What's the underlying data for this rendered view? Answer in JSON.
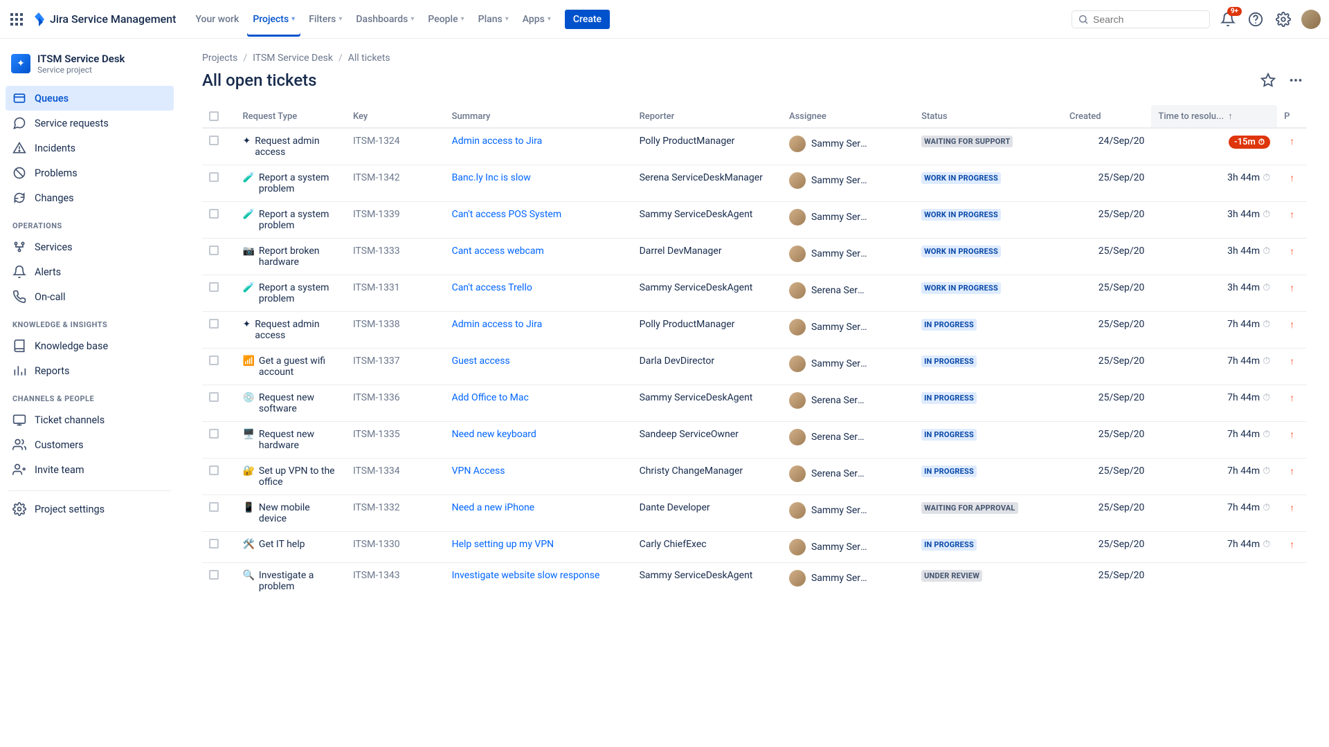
{
  "app": {
    "name": "Jira Service Management"
  },
  "nav": {
    "items": [
      {
        "label": "Your work",
        "caret": false
      },
      {
        "label": "Projects",
        "caret": true,
        "active": true
      },
      {
        "label": "Filters",
        "caret": true
      },
      {
        "label": "Dashboards",
        "caret": true
      },
      {
        "label": "People",
        "caret": true
      },
      {
        "label": "Plans",
        "caret": true
      },
      {
        "label": "Apps",
        "caret": true
      }
    ],
    "create": "Create",
    "search_placeholder": "Search",
    "notifications_badge": "9+"
  },
  "project": {
    "title": "ITSM Service Desk",
    "subtitle": "Service project"
  },
  "sidebar": {
    "main": [
      {
        "label": "Queues",
        "icon": "queue",
        "selected": true
      },
      {
        "label": "Service requests",
        "icon": "chat"
      },
      {
        "label": "Incidents",
        "icon": "incident"
      },
      {
        "label": "Problems",
        "icon": "problem"
      },
      {
        "label": "Changes",
        "icon": "changes"
      }
    ],
    "group_ops": "OPERATIONS",
    "ops": [
      {
        "label": "Services",
        "icon": "services"
      },
      {
        "label": "Alerts",
        "icon": "alerts"
      },
      {
        "label": "On-call",
        "icon": "oncall"
      }
    ],
    "group_ki": "KNOWLEDGE & INSIGHTS",
    "ki": [
      {
        "label": "Knowledge base",
        "icon": "kb"
      },
      {
        "label": "Reports",
        "icon": "reports"
      }
    ],
    "group_cp": "CHANNELS & PEOPLE",
    "cp": [
      {
        "label": "Ticket channels",
        "icon": "channels"
      },
      {
        "label": "Customers",
        "icon": "customers"
      },
      {
        "label": "Invite team",
        "icon": "invite"
      }
    ],
    "settings": {
      "label": "Project settings",
      "icon": "settings"
    }
  },
  "breadcrumbs": [
    "Projects",
    "ITSM Service Desk",
    "All tickets"
  ],
  "page_title": "All open tickets",
  "columns": {
    "request_type": "Request Type",
    "key": "Key",
    "summary": "Summary",
    "reporter": "Reporter",
    "assignee": "Assignee",
    "status": "Status",
    "created": "Created",
    "sla": "Time to resolu...",
    "p": "P"
  },
  "tickets": [
    {
      "type_icon": "✦",
      "type": "Request admin access",
      "key": "ITSM-1324",
      "summary": "Admin access to Jira",
      "reporter": "Polly ProductManager",
      "assignee": "Sammy Servi...",
      "status": "WAITING FOR SUPPORT",
      "status_style": "default",
      "created": "24/Sep/20",
      "sla": "-15m",
      "sla_breached": true,
      "priority": "high"
    },
    {
      "type_icon": "🧪",
      "type": "Report a system problem",
      "key": "ITSM-1342",
      "summary": "Banc.ly Inc is slow",
      "reporter": "Serena ServiceDeskManager",
      "assignee": "Sammy Servi...",
      "status": "WORK IN PROGRESS",
      "status_style": "inprogress",
      "created": "25/Sep/20",
      "sla": "3h 44m",
      "priority": "high"
    },
    {
      "type_icon": "🧪",
      "type": "Report a system problem",
      "key": "ITSM-1339",
      "summary": "Can't access POS System",
      "reporter": "Sammy ServiceDeskAgent",
      "assignee": "Sammy Servi...",
      "status": "WORK IN PROGRESS",
      "status_style": "inprogress",
      "created": "25/Sep/20",
      "sla": "3h 44m",
      "priority": "high"
    },
    {
      "type_icon": "📷",
      "type": "Report broken hardware",
      "key": "ITSM-1333",
      "summary": "Cant access webcam",
      "reporter": "Darrel DevManager",
      "assignee": "Sammy Servi...",
      "status": "WORK IN PROGRESS",
      "status_style": "inprogress",
      "created": "25/Sep/20",
      "sla": "3h 44m",
      "priority": "high"
    },
    {
      "type_icon": "🧪",
      "type": "Report a system problem",
      "key": "ITSM-1331",
      "summary": "Can't access Trello",
      "reporter": "Sammy ServiceDeskAgent",
      "assignee": "Serena Servi...",
      "status": "WORK IN PROGRESS",
      "status_style": "inprogress",
      "created": "25/Sep/20",
      "sla": "3h 44m",
      "priority": "high"
    },
    {
      "type_icon": "✦",
      "type": "Request admin access",
      "key": "ITSM-1338",
      "summary": "Admin access to Jira",
      "reporter": "Polly ProductManager",
      "assignee": "Sammy Servi...",
      "status": "IN PROGRESS",
      "status_style": "inprogress",
      "created": "25/Sep/20",
      "sla": "7h 44m",
      "priority": "high"
    },
    {
      "type_icon": "📶",
      "type": "Get a guest wifi account",
      "key": "ITSM-1337",
      "summary": "Guest access",
      "reporter": "Darla DevDirector",
      "assignee": "Sammy Servi...",
      "status": "IN PROGRESS",
      "status_style": "inprogress",
      "created": "25/Sep/20",
      "sla": "7h 44m",
      "priority": "high"
    },
    {
      "type_icon": "💿",
      "type": "Request new software",
      "key": "ITSM-1336",
      "summary": "Add Office to Mac",
      "reporter": "Sammy ServiceDeskAgent",
      "assignee": "Serena Servi...",
      "status": "IN PROGRESS",
      "status_style": "inprogress",
      "created": "25/Sep/20",
      "sla": "7h 44m",
      "priority": "high"
    },
    {
      "type_icon": "🖥️",
      "type": "Request new hardware",
      "key": "ITSM-1335",
      "summary": "Need new keyboard",
      "reporter": "Sandeep ServiceOwner",
      "assignee": "Serena Servi...",
      "status": "IN PROGRESS",
      "status_style": "inprogress",
      "created": "25/Sep/20",
      "sla": "7h 44m",
      "priority": "high"
    },
    {
      "type_icon": "🔐",
      "type": "Set up VPN to the office",
      "key": "ITSM-1334",
      "summary": "VPN Access",
      "reporter": "Christy ChangeManager",
      "assignee": "Serena Servi...",
      "status": "IN PROGRESS",
      "status_style": "inprogress",
      "created": "25/Sep/20",
      "sla": "7h 44m",
      "priority": "high"
    },
    {
      "type_icon": "📱",
      "type": "New mobile device",
      "key": "ITSM-1332",
      "summary": "Need a new iPhone",
      "reporter": "Dante Developer",
      "assignee": "Sammy Servi...",
      "status": "WAITING FOR APPROVAL",
      "status_style": "default",
      "created": "25/Sep/20",
      "sla": "7h 44m",
      "priority": "high"
    },
    {
      "type_icon": "🛠️",
      "type": "Get IT help",
      "key": "ITSM-1330",
      "summary": "Help setting up my VPN",
      "reporter": "Carly ChiefExec",
      "assignee": "Sammy Servi...",
      "status": "IN PROGRESS",
      "status_style": "inprogress",
      "created": "25/Sep/20",
      "sla": "7h 44m",
      "priority": "high"
    },
    {
      "type_icon": "🔍",
      "type": "Investigate a problem",
      "key": "ITSM-1343",
      "summary": "Investigate website slow response",
      "reporter": "Sammy ServiceDeskAgent",
      "assignee": "Sammy Servi...",
      "status": "UNDER REVIEW",
      "status_style": "default",
      "created": "25/Sep/20",
      "sla": "",
      "priority": ""
    }
  ]
}
